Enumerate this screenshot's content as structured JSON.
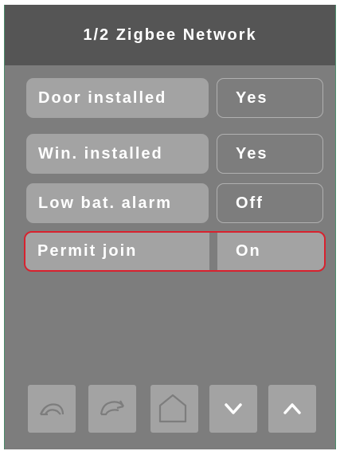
{
  "header": {
    "title": "1/2 Zigbee Network"
  },
  "settings": [
    {
      "label": "Door installed",
      "value": "Yes",
      "selected": false
    },
    {
      "label": "Win. installed",
      "value": "Yes",
      "selected": false
    },
    {
      "label": "Low bat. alarm",
      "value": "Off",
      "selected": false
    },
    {
      "label": "Permit join",
      "value": "On",
      "selected": true
    }
  ],
  "nav": {
    "buttons": [
      "undo-icon",
      "redo-icon",
      "home-icon",
      "chevron-down-icon",
      "chevron-up-icon"
    ]
  },
  "colors": {
    "screen_bg": "#7d7d7d",
    "header_bg": "#555555",
    "label_bg": "#a3a3a3",
    "selection_border": "#d8222e",
    "text": "#ffffff"
  }
}
